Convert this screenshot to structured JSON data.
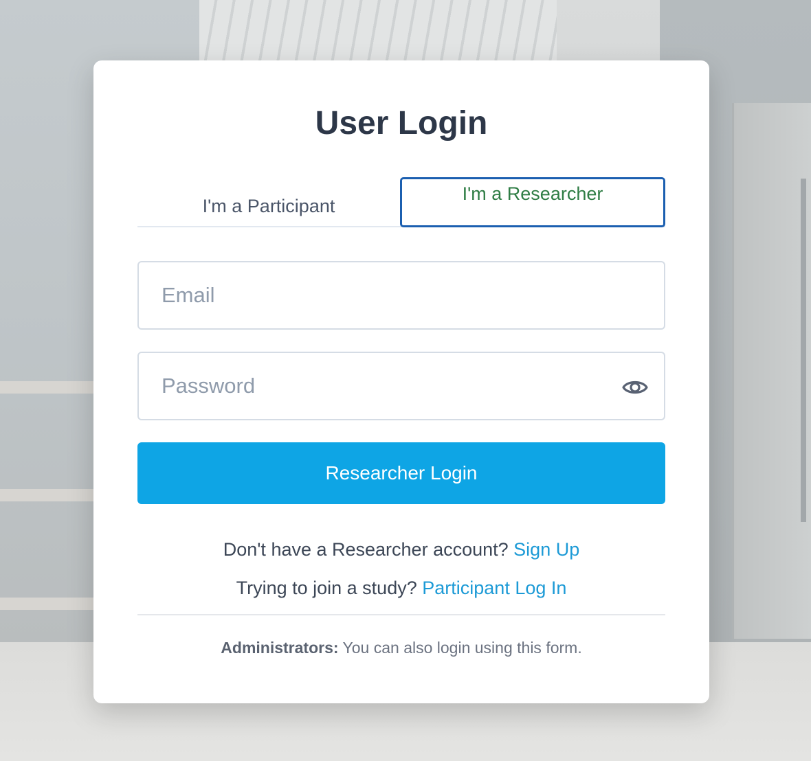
{
  "login": {
    "title": "User Login",
    "tabs": [
      {
        "label": "I'm a Participant",
        "selected": false
      },
      {
        "label": "I'm a Researcher",
        "selected": true
      }
    ],
    "email": {
      "placeholder": "Email",
      "value": ""
    },
    "password": {
      "placeholder": "Password",
      "value": "",
      "toggle_icon": "eye-icon"
    },
    "submit_label": "Researcher Login",
    "signup_prompt": "Don't have a Researcher account?",
    "signup_link": "Sign Up",
    "join_prompt": "Trying to join a study?",
    "join_link": "Participant Log In",
    "admin_label": "Administrators:",
    "admin_note": "You can also login using this form."
  },
  "colors": {
    "primary_button": "#0ea5e5",
    "link": "#1c9ad6",
    "active_tab_text": "#2f7d45",
    "active_tab_border": "#1b5fb0",
    "title": "#2d3748"
  }
}
